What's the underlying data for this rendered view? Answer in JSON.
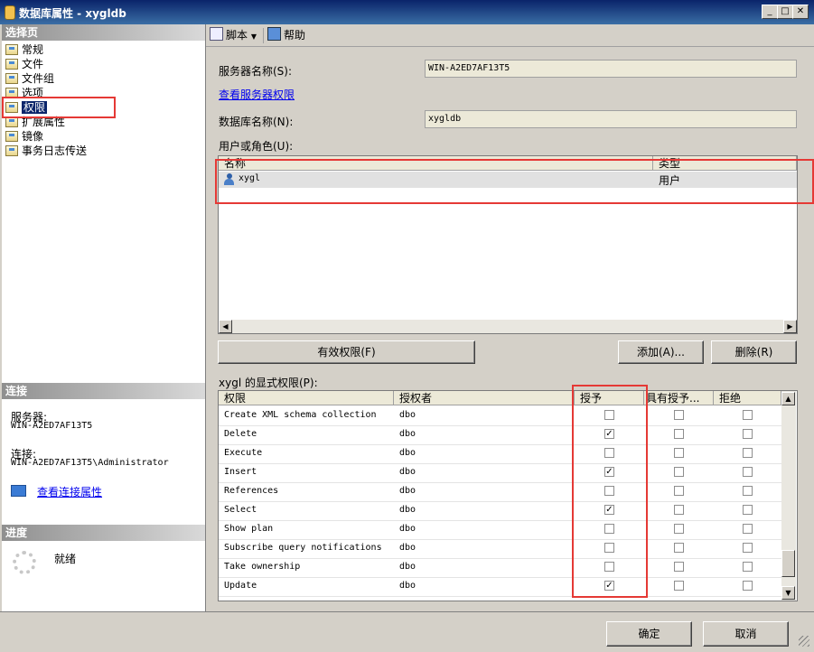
{
  "window": {
    "title": "数据库属性 - xygldb"
  },
  "left": {
    "select_page_header": "选择页",
    "nav_items": [
      "常规",
      "文件",
      "文件组",
      "选项",
      "权限",
      "扩展属性",
      "镜像",
      "事务日志传送"
    ],
    "selected_index": 4,
    "connection_header": "连接",
    "server_label": "服务器:",
    "server_value": "WIN-A2ED7AF13T5",
    "connection_label": "连接:",
    "connection_value": "WIN-A2ED7AF13T5\\Administrator",
    "view_conn_props": "查看连接属性",
    "progress_header": "进度",
    "progress_status": "就绪"
  },
  "toolbar": {
    "script_label": "脚本",
    "help_label": "帮助"
  },
  "main": {
    "server_name_label": "服务器名称(S):",
    "server_name_value": "WIN-A2ED7AF13T5",
    "view_server_perms": "查看服务器权限",
    "db_name_label": "数据库名称(N):",
    "db_name_value": "xygldb",
    "users_roles_label": "用户或角色(U):",
    "users_columns": [
      "名称",
      "类型"
    ],
    "users_rows": [
      {
        "name": "xygl",
        "type": "用户"
      }
    ],
    "effective_perms_button": "有效权限(F)",
    "add_button": "添加(A)...",
    "remove_button": "删除(R)",
    "explicit_perms_label": "xygl 的显式权限(P):",
    "perm_columns": [
      "权限",
      "授权者",
      "授予",
      "具有授予...",
      "拒绝"
    ],
    "perm_rows": [
      {
        "perm": "Create XML schema collection",
        "grantor": "dbo",
        "grant": false,
        "with_grant": false,
        "deny": false
      },
      {
        "perm": "Delete",
        "grantor": "dbo",
        "grant": true,
        "with_grant": false,
        "deny": false
      },
      {
        "perm": "Execute",
        "grantor": "dbo",
        "grant": false,
        "with_grant": false,
        "deny": false
      },
      {
        "perm": "Insert",
        "grantor": "dbo",
        "grant": true,
        "with_grant": false,
        "deny": false
      },
      {
        "perm": "References",
        "grantor": "dbo",
        "grant": false,
        "with_grant": false,
        "deny": false
      },
      {
        "perm": "Select",
        "grantor": "dbo",
        "grant": true,
        "with_grant": false,
        "deny": false
      },
      {
        "perm": "Show plan",
        "grantor": "dbo",
        "grant": false,
        "with_grant": false,
        "deny": false
      },
      {
        "perm": "Subscribe query notifications",
        "grantor": "dbo",
        "grant": false,
        "with_grant": false,
        "deny": false
      },
      {
        "perm": "Take ownership",
        "grantor": "dbo",
        "grant": false,
        "with_grant": false,
        "deny": false
      },
      {
        "perm": "Update",
        "grantor": "dbo",
        "grant": true,
        "with_grant": false,
        "deny": false
      }
    ]
  },
  "footer": {
    "ok_button": "确定",
    "cancel_button": "取消"
  },
  "colors": {
    "highlight_box": "#e53935",
    "title_bar": "#0a246a",
    "link": "#0000ee"
  }
}
